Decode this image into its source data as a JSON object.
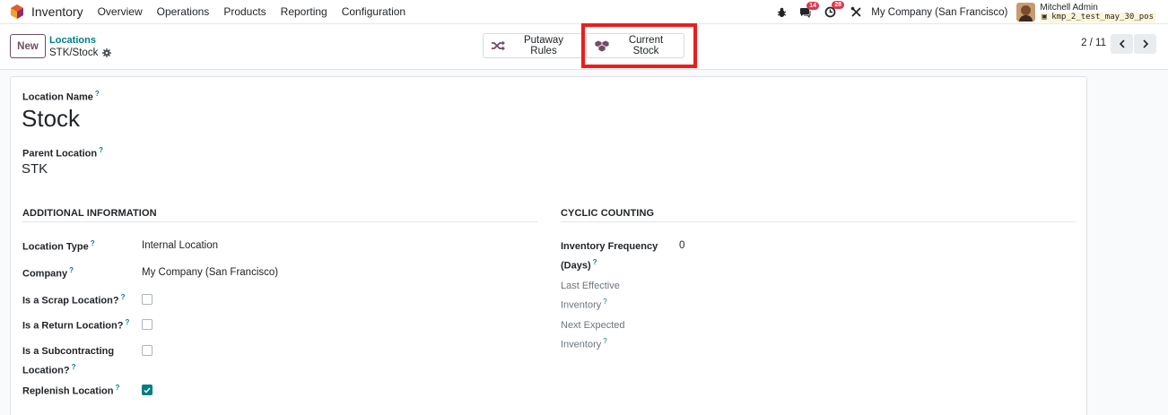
{
  "navbar": {
    "app_name": "Inventory",
    "menu": [
      "Overview",
      "Operations",
      "Products",
      "Reporting",
      "Configuration"
    ],
    "messages_badge": "14",
    "activity_badge": "28",
    "company": "My Company (San Francisco)",
    "user_name": "Mitchell Admin",
    "database": "kmp_2_test_may_30_pos"
  },
  "control": {
    "new_label": "New",
    "breadcrumb_parent": "Locations",
    "breadcrumb_current": "STK/Stock",
    "putaway_label": "Putaway Rules",
    "current_stock_label": "Current Stock",
    "pager": "2 / 11"
  },
  "form": {
    "location_name_label": "Location Name",
    "location_name": "Stock",
    "parent_location_label": "Parent Location",
    "parent_location": "STK",
    "additional_info_title": "ADDITIONAL INFORMATION",
    "cyclic_counting_title": "CYCLIC COUNTING",
    "location_type_label": "Location Type",
    "location_type": "Internal Location",
    "company_label": "Company",
    "company": "My Company (San Francisco)",
    "scrap_label": "Is a Scrap Location?",
    "return_label": "Is a Return Location?",
    "subcontracting_label_1": "Is a Subcontracting",
    "subcontracting_label_2": "Location?",
    "replenish_label": "Replenish Location",
    "inv_freq_label_1": "Inventory Frequency",
    "inv_freq_label_2": "(Days)",
    "inv_freq_value": "0",
    "last_eff_label_1": "Last Effective",
    "last_eff_label_2": "Inventory",
    "next_exp_label_1": "Next Expected",
    "next_exp_label_2": "Inventory",
    "help_mark": "?"
  },
  "checkboxes": {
    "is_scrap": false,
    "is_return": false,
    "is_subcontracting": false,
    "replenish": true
  },
  "colors": {
    "brand": "#714b67",
    "link": "#017e84",
    "badge": "#e0364a",
    "highlight": "#ee1c1c"
  }
}
